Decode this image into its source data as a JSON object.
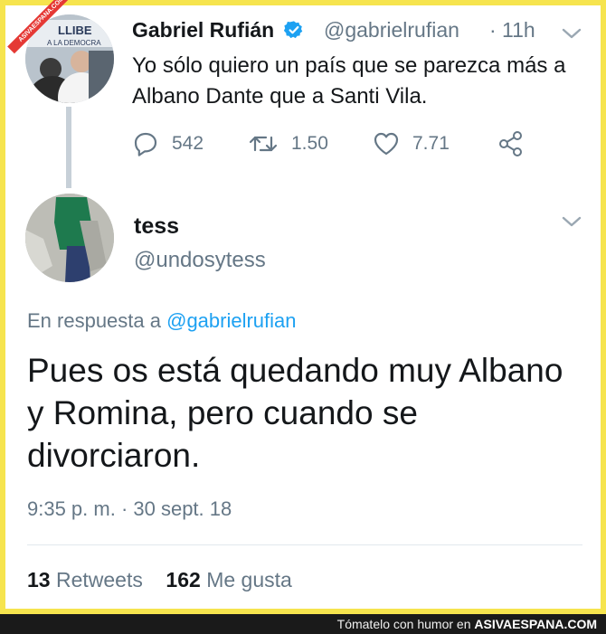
{
  "watermark": {
    "badge": "ASIVAESPANA.COM"
  },
  "tweet1": {
    "name": "Gabriel Rufián",
    "handle": "@gabrielrufian",
    "time": "· 11h",
    "avatar_sign": "LLIBE",
    "avatar_sign2": "A LA DEMOCRA",
    "text": "Yo sólo quiero un país que se parezca más a Albano Dante que a Santi Vila.",
    "replies": "542",
    "retweets": "1.50",
    "likes": "7.71"
  },
  "tweet2": {
    "name": "tess",
    "handle": "@undosytess",
    "reply_prefix": "En respuesta a",
    "reply_mention": "@gabrielrufian",
    "text": "Pues os está quedando muy Albano y Romina, pero cuando se divorciaron.",
    "timestamp": "9:35 p. m. · 30 sept. 18",
    "retweets_count": "13",
    "retweets_label": "Retweets",
    "likes_count": "162",
    "likes_label": "Me gusta"
  },
  "footer": {
    "text": "Tómatelo con humor en",
    "site": "ASIVAESPANA.COM"
  },
  "colors": {
    "background": "#f6e44e",
    "link": "#1da1f2",
    "secondary": "#657786",
    "primary": "#14171a"
  }
}
